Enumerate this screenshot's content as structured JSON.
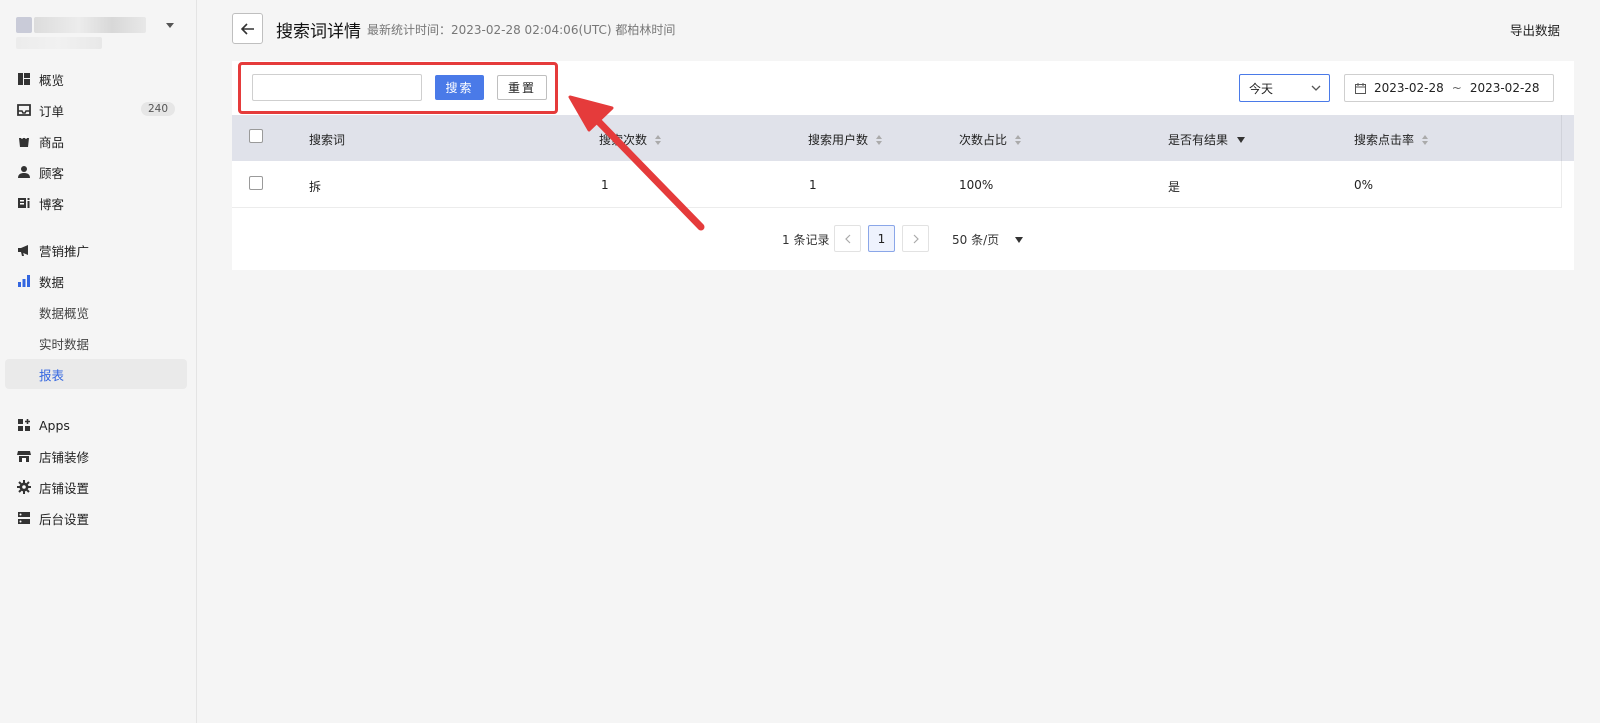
{
  "header": {
    "title": "搜索词详情",
    "stat_time": "最新统计时间：2023-02-28 02:04:06(UTC) 都柏林时间",
    "export_label": "导出数据"
  },
  "sidebar": {
    "items": [
      {
        "label": "概览",
        "icon": "overview-icon"
      },
      {
        "label": "订单",
        "icon": "inbox-icon",
        "badge": "240"
      },
      {
        "label": "商品",
        "icon": "bag-icon"
      },
      {
        "label": "顾客",
        "icon": "person-icon"
      },
      {
        "label": "博客",
        "icon": "blog-icon"
      },
      {
        "label": "营销推广",
        "icon": "megaphone-icon"
      },
      {
        "label": "数据",
        "icon": "bar-chart-icon"
      },
      {
        "label": "Apps",
        "icon": "apps-icon"
      },
      {
        "label": "店铺装修",
        "icon": "store-icon"
      },
      {
        "label": "店铺设置",
        "icon": "gear-icon"
      },
      {
        "label": "后台设置",
        "icon": "server-icon"
      }
    ],
    "data_sub": [
      "数据概览",
      "实时数据",
      "报表"
    ],
    "active_sub": "报表"
  },
  "filters": {
    "search_value": "",
    "search_label": "搜索",
    "reset_label": "重置",
    "period": "今天",
    "date_start": "2023-02-28",
    "date_sep": "~",
    "date_end": "2023-02-28"
  },
  "table": {
    "columns": [
      "搜索词",
      "搜索次数",
      "搜索用户数",
      "次数占比",
      "是否有结果",
      "搜索点击率"
    ],
    "rows": [
      [
        "拆",
        "1",
        "1",
        "100%",
        "是",
        "0%"
      ]
    ]
  },
  "pagination": {
    "total": "1 条记录",
    "current_page": "1",
    "page_size": "50 条/页"
  },
  "colors": {
    "accent": "#4a7ae8",
    "annotation": "#e53b3b"
  }
}
